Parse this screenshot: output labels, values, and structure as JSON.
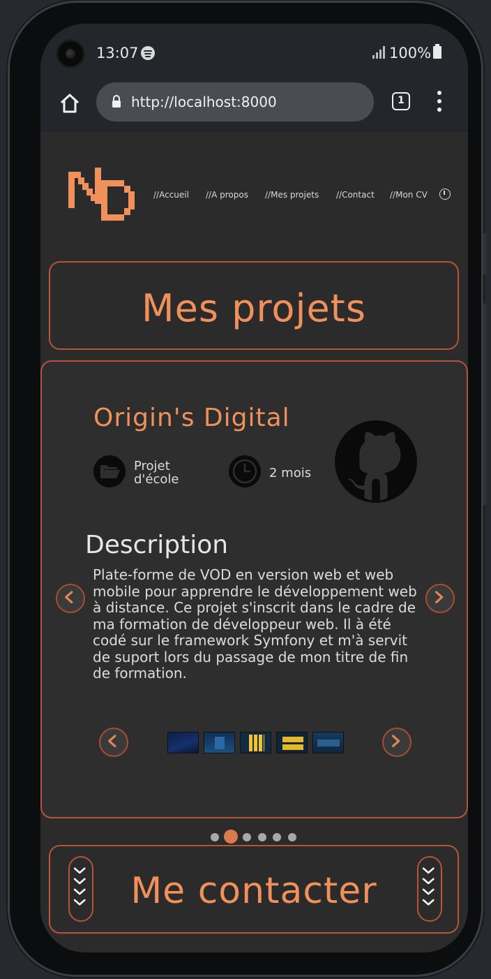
{
  "status_bar": {
    "time": "13:07",
    "battery": "100%"
  },
  "browser": {
    "url": "http://localhost:8000",
    "tab_count": "1"
  },
  "nav": {
    "items": [
      "//Accueil",
      "//A propos",
      "//Mes projets",
      "//Contact",
      "//Mon CV"
    ]
  },
  "section_title": "Mes projets",
  "project": {
    "title": "Origin's Digital",
    "type_line1": "Projet",
    "type_line2": "d'école",
    "duration": "2 mois",
    "description_title": "Description",
    "description": "Plate-forme de VOD en version web et web mobile pour apprendre le développement web à distance. Ce projet s'inscrit dans le cadre de ma formation de développeur web. Il à été codé sur le framework Symfony et m'à servit de suport lors du passage de mon titre de fin de formation."
  },
  "carousel": {
    "slide_count": 6,
    "active_index": 1
  },
  "contact_title": "Me contacter",
  "colors": {
    "accent": "#f0905a",
    "border": "#b8533c",
    "background": "#2b2b2b"
  },
  "icons": [
    "home-icon",
    "lock-icon",
    "tabs-icon",
    "more-menu-icon",
    "spotify-icon",
    "signal-icon",
    "battery-icon",
    "folder-icon",
    "clock-icon",
    "github-icon",
    "chevron-left-icon",
    "chevron-right-icon",
    "chevrons-down-icon"
  ]
}
